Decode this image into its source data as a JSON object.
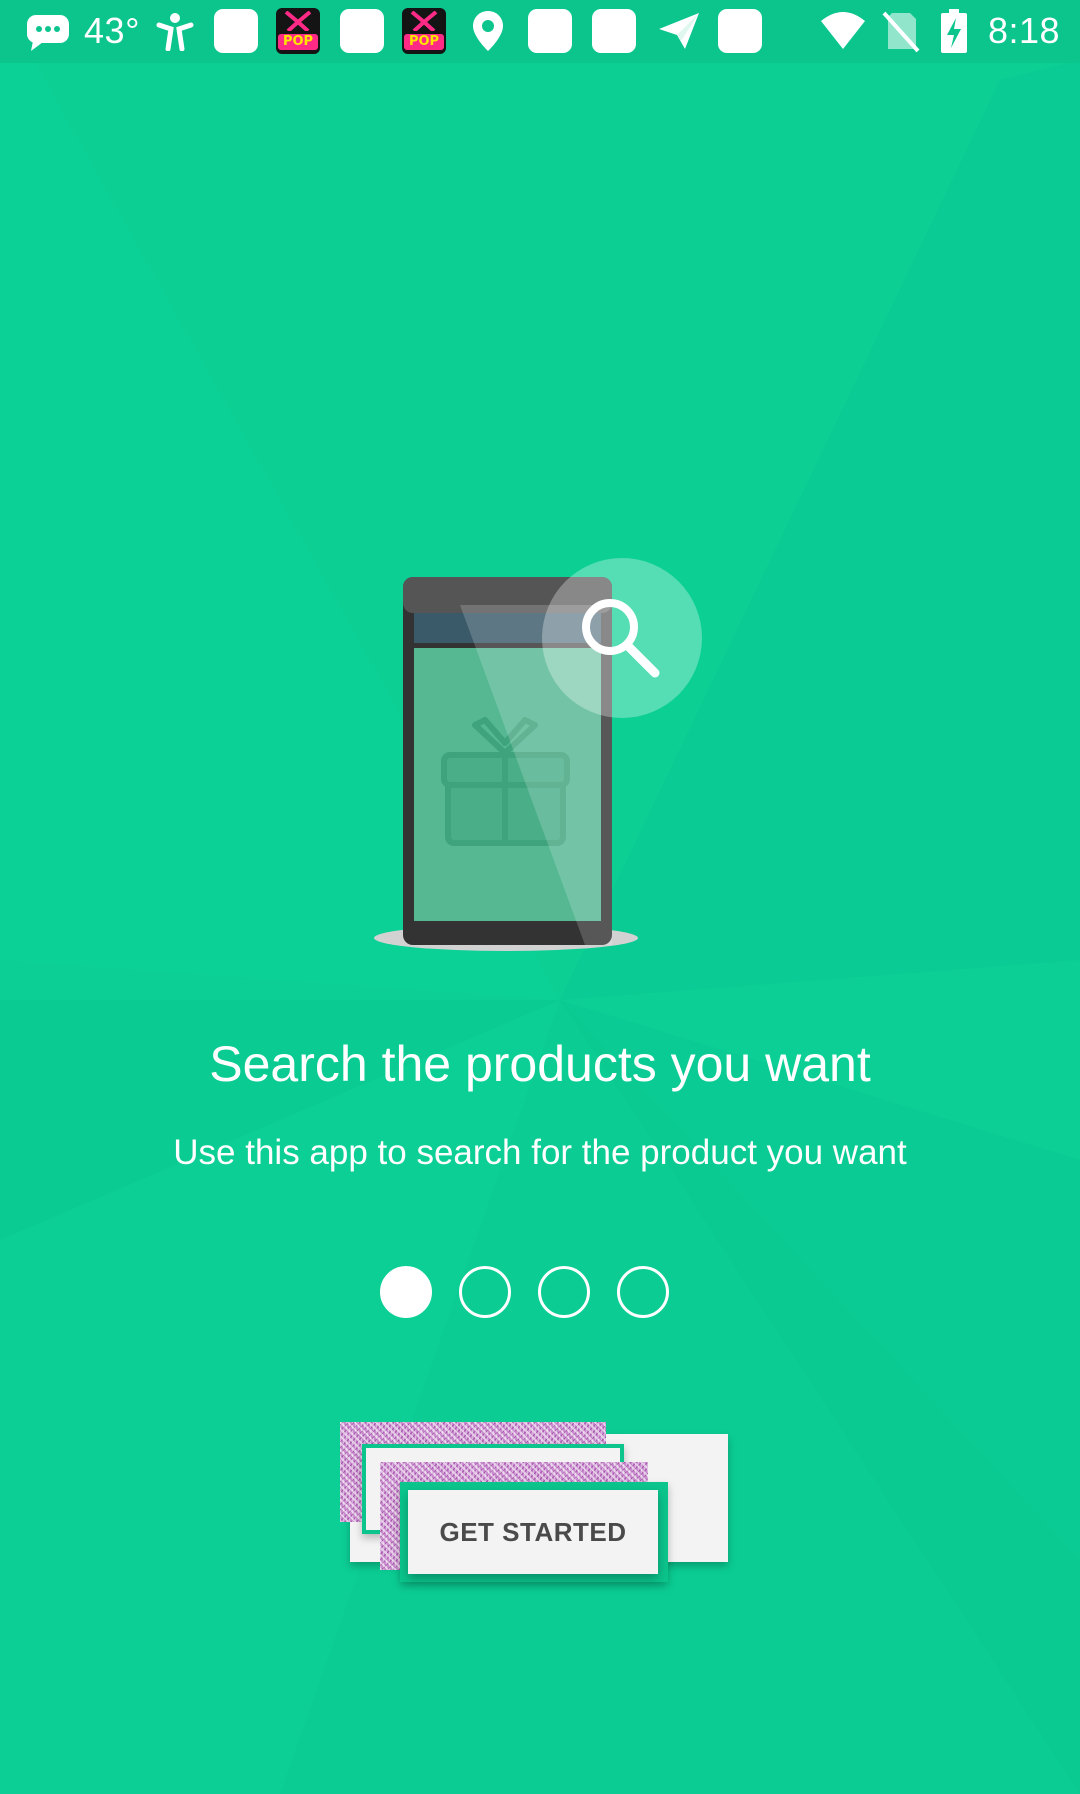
{
  "status_bar": {
    "temperature": "43°",
    "time": "8:18",
    "kpop_label": "POP",
    "left_icons": [
      "sms-icon",
      "accessibility-icon",
      "app-square-icon",
      "kpop-app-icon",
      "app-square-icon",
      "kpop-app-icon",
      "location-icon",
      "app-square-icon",
      "app-square-icon",
      "send-icon",
      "app-square-icon"
    ],
    "right_icons": [
      "wifi-icon",
      "no-sim-icon",
      "battery-charging-icon"
    ]
  },
  "onboarding": {
    "title": "Search the products you want",
    "subtitle": "Use this app to search for the product you want",
    "page_indicator": {
      "total": 4,
      "current": 1
    },
    "cta_label": "GET STARTED",
    "illustration": "phone-search-gift-illustration"
  },
  "colors": {
    "background": "#0ccf94",
    "status_bar": "#0bc58d",
    "text": "#ffffff",
    "button_bg": "#f3f3f3",
    "button_text": "#4a4a4a"
  }
}
